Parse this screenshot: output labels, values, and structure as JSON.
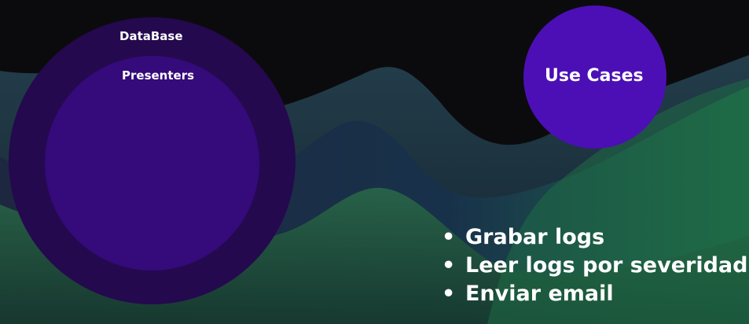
{
  "diagram": {
    "outer_circle_label": "DataBase",
    "inner_circle_label": "Presenters",
    "use_cases_label": "Use Cases"
  },
  "bullet_list": {
    "marker": "•",
    "items": [
      "Grabar logs",
      "Leer logs por severidad",
      "Enviar email"
    ]
  },
  "colors": {
    "background": "#0b0b0e",
    "hills_green": "#1f5a3a",
    "hills_navy": "#1a2338",
    "outer_circle": "#24094f",
    "inner_circle": "#350a7a",
    "use_cases_circle": "#4c0fb5",
    "text": "#ffffff"
  }
}
